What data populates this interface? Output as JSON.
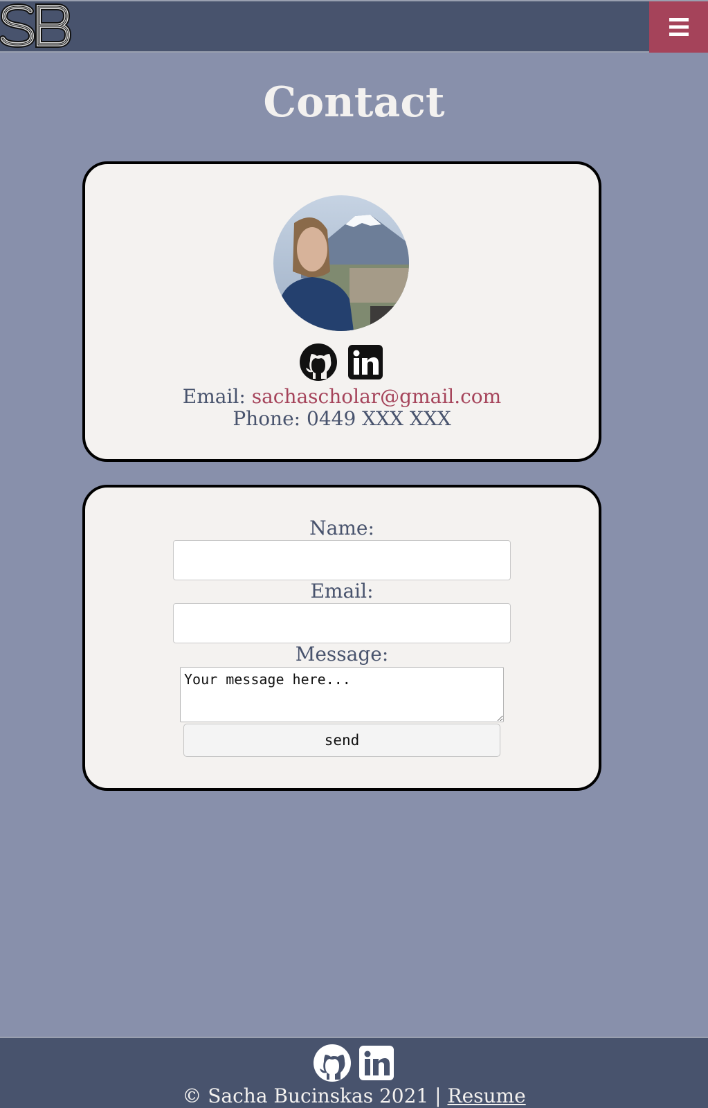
{
  "navbar": {
    "logo_text": "SB",
    "menu_icon": "hamburger-menu-icon",
    "colors": {
      "bar": "#48536d",
      "menu": "#a5435a"
    }
  },
  "page": {
    "title": "Contact",
    "background": "#8890ab"
  },
  "profile": {
    "avatar_icon": "profile-photo",
    "social_icons": [
      "github-icon",
      "linkedin-icon"
    ],
    "email_label": "Email: ",
    "email_value": "sachascholar@gmail.com",
    "phone_label": "Phone: ",
    "phone_value": "0449 XXX XXX"
  },
  "form": {
    "name_label": "Name:",
    "name_value": "",
    "email_label": "Email:",
    "email_value": "",
    "message_label": "Message:",
    "message_placeholder": "Your message here...",
    "send_label": "send"
  },
  "footer": {
    "social_icons": [
      "github-icon",
      "linkedin-icon"
    ],
    "copyright": "© Sacha Bucinskas 2021 | ",
    "resume_link": "Resume"
  },
  "colors": {
    "accent": "#a5435a",
    "text": "#48536d",
    "card": "#f4f2f0"
  }
}
